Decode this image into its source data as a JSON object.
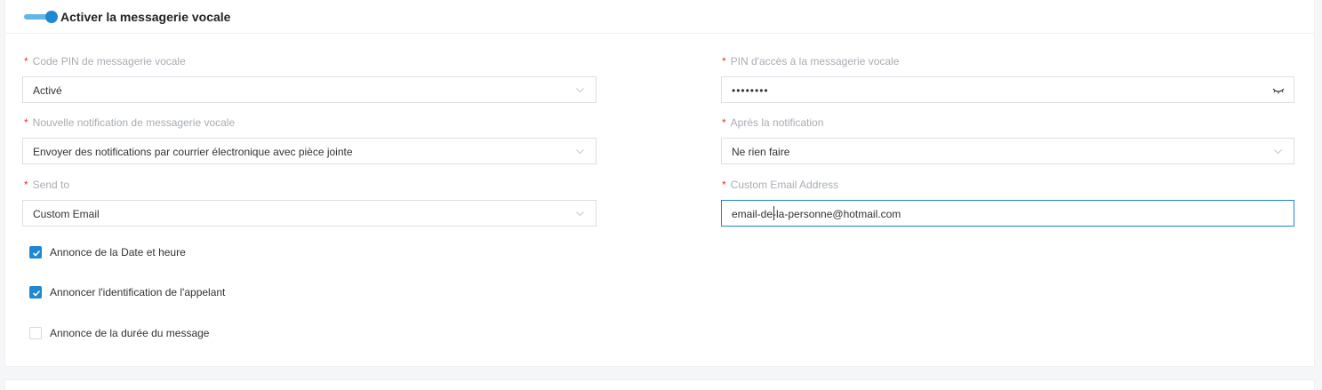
{
  "section": {
    "title": "Activer la messagerie vocale",
    "enabled": true
  },
  "fields": {
    "pin_mode": {
      "label": "Code PIN de messagerie vocale",
      "value": "Activé"
    },
    "pin_access": {
      "label": "PIN d'accès à la messagerie vocale",
      "value": "••••••••"
    },
    "new_notification": {
      "label": "Nouvelle notification de messagerie vocale",
      "value": "Envoyer des notifications par courrier électronique avec pièce jointe"
    },
    "after_notification": {
      "label": "Après la notification",
      "value": "Ne rien faire"
    },
    "send_to": {
      "label": "Send to",
      "value": "Custom Email"
    },
    "custom_email": {
      "label": "Custom Email Address",
      "value": "email-de-la-personne@hotmail.com"
    }
  },
  "required_marker": "*",
  "checkboxes": [
    {
      "label": "Annonce de la Date et heure",
      "checked": true
    },
    {
      "label": "Annoncer l'identification de l'appelant",
      "checked": true
    },
    {
      "label": "Annonce de la durée du message",
      "checked": false
    }
  ],
  "colors": {
    "accent": "#1e88d3",
    "required": "#e0342a",
    "label": "#a8adb3"
  }
}
